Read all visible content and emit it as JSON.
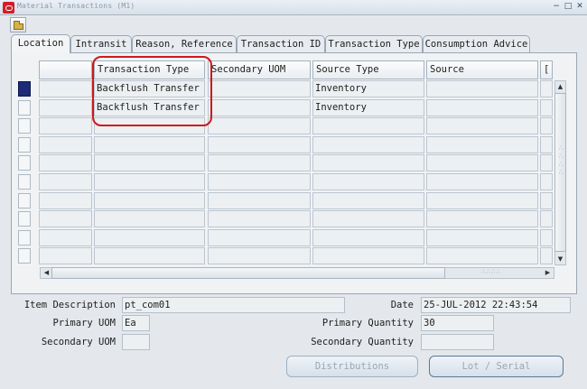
{
  "window": {
    "title": "Material Transactions (M1)",
    "controls": {
      "minimize": "−",
      "maximize": "□",
      "close": "✕"
    }
  },
  "toolbar": {
    "icon": "open-folder-icon"
  },
  "tabs": [
    {
      "label": "Location",
      "active": true
    },
    {
      "label": "Intransit",
      "active": false
    },
    {
      "label": "Reason, Reference",
      "active": false
    },
    {
      "label": "Transaction ID",
      "active": false
    },
    {
      "label": "Transaction Type",
      "active": false
    },
    {
      "label": "Consumption Advice",
      "active": false
    }
  ],
  "grid": {
    "columns": [
      "",
      "Transaction Type",
      "Secondary UOM",
      "Source Type",
      "Source",
      "["
    ],
    "rows": [
      [
        "",
        "Backflush Transfer",
        "",
        "Inventory",
        "",
        ""
      ],
      [
        "",
        "Backflush Transfer",
        "",
        "Inventory",
        "",
        ""
      ],
      [
        "",
        "",
        "",
        "",
        "",
        ""
      ],
      [
        "",
        "",
        "",
        "",
        "",
        ""
      ],
      [
        "",
        "",
        "",
        "",
        "",
        ""
      ],
      [
        "",
        "",
        "",
        "",
        "",
        ""
      ],
      [
        "",
        "",
        "",
        "",
        "",
        ""
      ],
      [
        "",
        "",
        "",
        "",
        "",
        ""
      ],
      [
        "",
        "",
        "",
        "",
        "",
        ""
      ],
      [
        "",
        "",
        "",
        "",
        "",
        ""
      ]
    ],
    "current_row": 0,
    "annotation_color": "#d01818"
  },
  "details": {
    "item_description": {
      "label": "Item Description",
      "value": "pt_com01"
    },
    "primary_uom": {
      "label": "Primary UOM",
      "value": "Ea"
    },
    "secondary_uom": {
      "label": "Secondary UOM",
      "value": ""
    },
    "date": {
      "label": "Date",
      "value": "25-JUL-2012 22:43:54"
    },
    "primary_quantity": {
      "label": "Primary Quantity",
      "value": "30"
    },
    "secondary_quantity": {
      "label": "Secondary Quantity",
      "value": ""
    }
  },
  "buttons": {
    "distributions": "Distributions",
    "lot_serial": "Lot / Serial"
  },
  "scroll": {
    "up": "▲",
    "down": "▼",
    "left": "◀",
    "right": "▶",
    "grip": "∴∴∴∴"
  }
}
